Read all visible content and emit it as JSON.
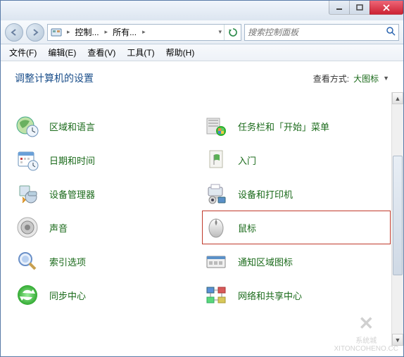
{
  "breadcrumb": {
    "seg1": "控制...",
    "seg2": "所有..."
  },
  "search": {
    "placeholder": "搜索控制面板"
  },
  "menu": {
    "file": "文件(F)",
    "edit": "编辑(E)",
    "view": "查看(V)",
    "tools": "工具(T)",
    "help": "帮助(H)"
  },
  "heading": "调整计算机的设置",
  "viewby": {
    "label": "查看方式:",
    "mode": "大图标"
  },
  "items": {
    "region": "区域和语言",
    "datetime": "日期和时间",
    "devmgr": "设备管理器",
    "sound": "声音",
    "index": "索引选项",
    "sync": "同步中心",
    "taskbar": "任务栏和「开始」菜单",
    "getstarted": "入门",
    "devprint": "设备和打印机",
    "mouse": "鼠标",
    "tray": "通知区域图标",
    "network": "网络和共享中心"
  },
  "watermark": {
    "brand": "系统城",
    "url": "XITONCOHENO.CC"
  }
}
